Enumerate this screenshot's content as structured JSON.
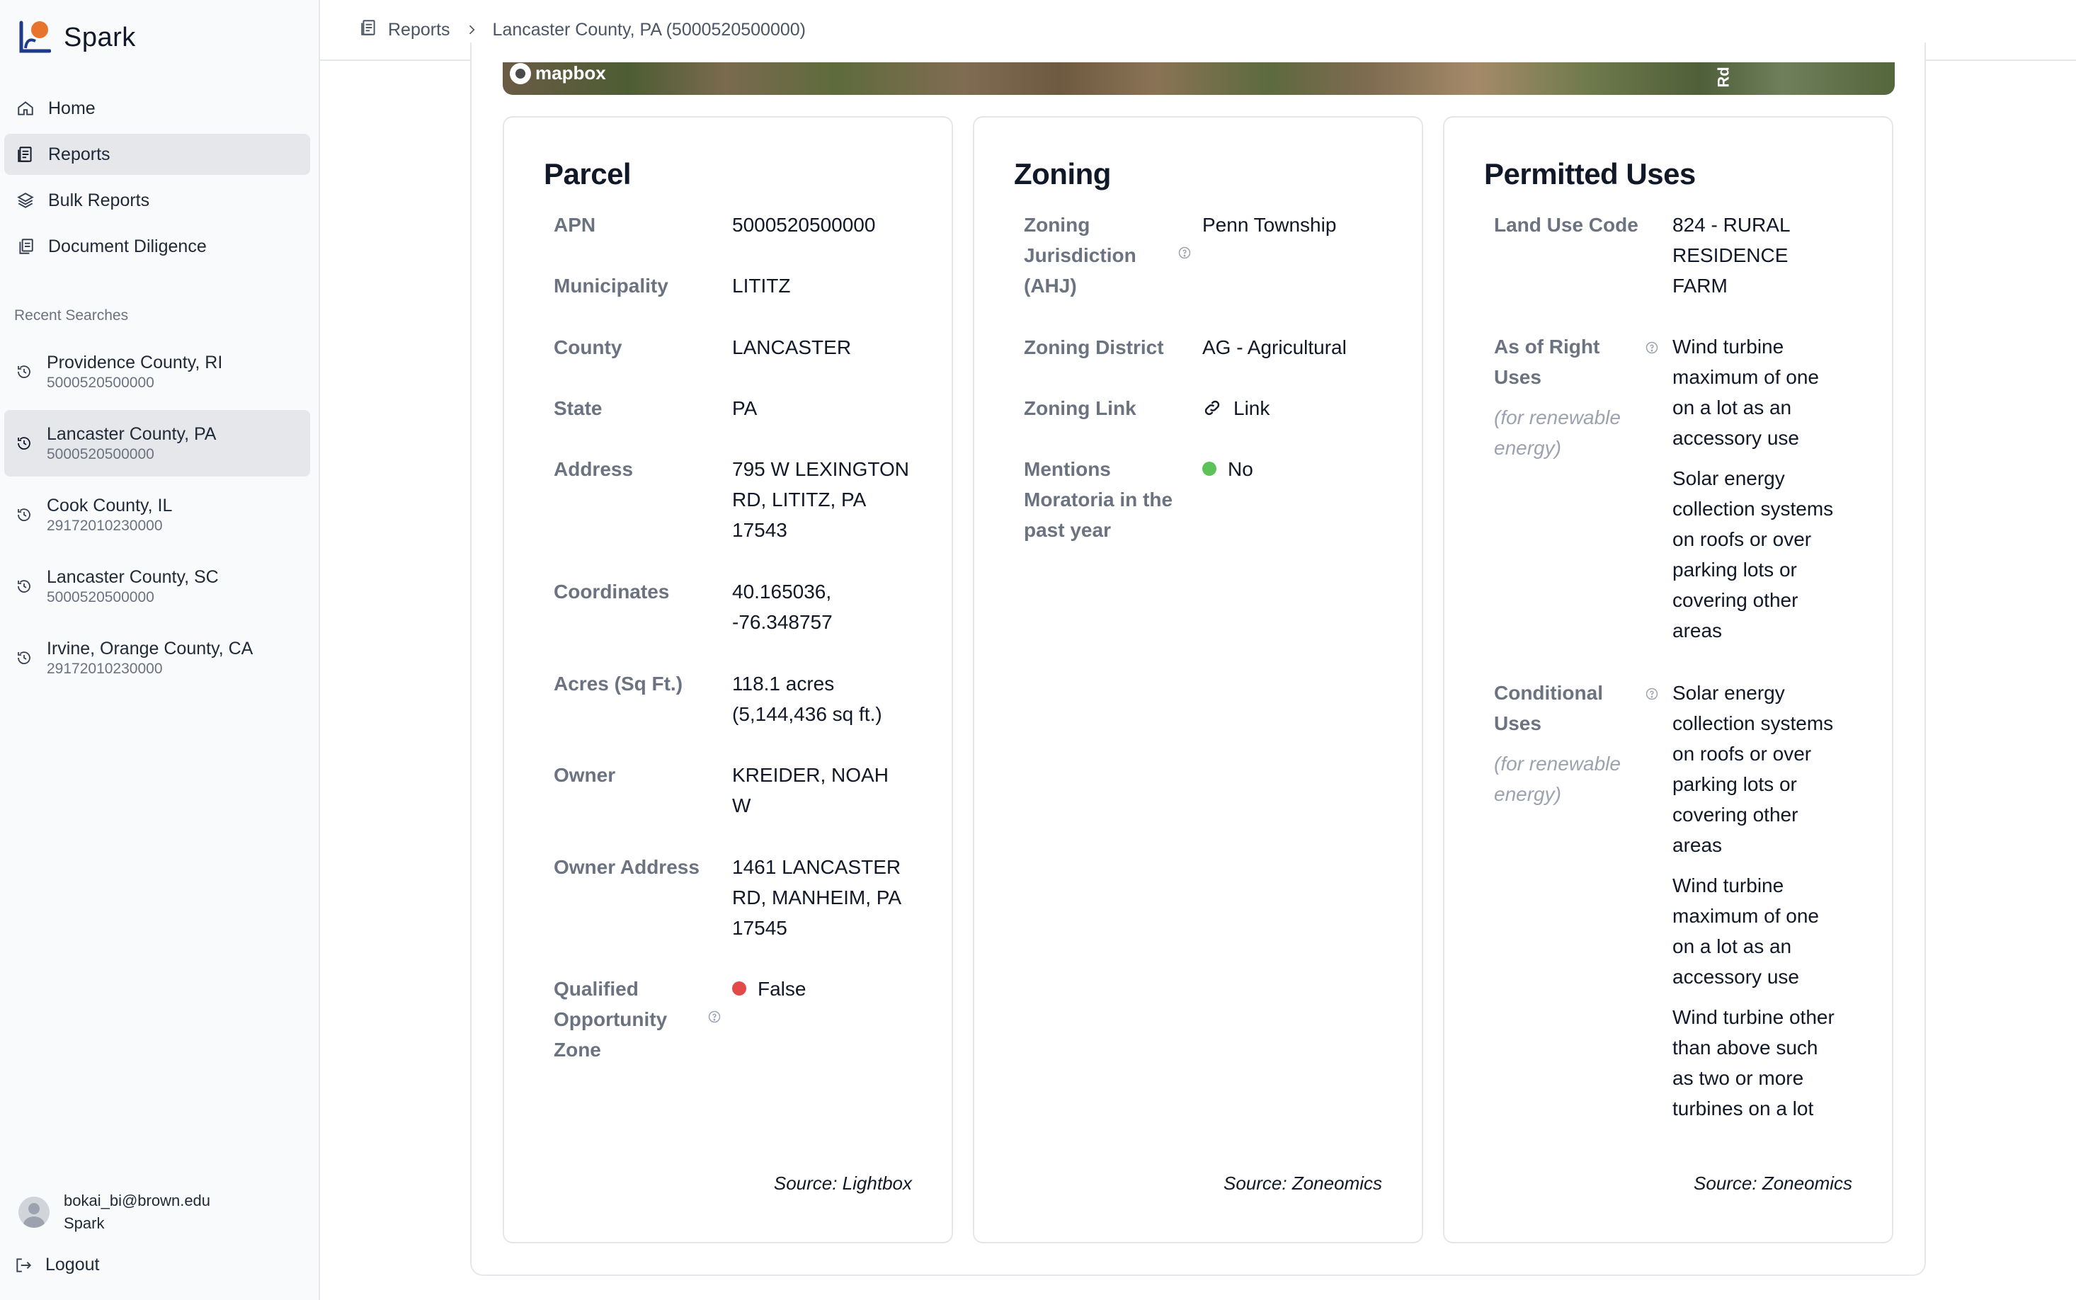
{
  "app": {
    "name": "Spark"
  },
  "nav": {
    "items": [
      {
        "label": "Home",
        "icon": "home-icon",
        "active": false
      },
      {
        "label": "Reports",
        "icon": "reports-icon",
        "active": true
      },
      {
        "label": "Bulk Reports",
        "icon": "layers-icon",
        "active": false
      },
      {
        "label": "Document Diligence",
        "icon": "documents-icon",
        "active": false
      }
    ]
  },
  "recent": {
    "title": "Recent Searches",
    "items": [
      {
        "name": "Providence County, RI",
        "id": "5000520500000"
      },
      {
        "name": "Lancaster County, PA",
        "id": "5000520500000"
      },
      {
        "name": "Cook County, IL",
        "id": "29172010230000"
      },
      {
        "name": "Lancaster County, SC",
        "id": "5000520500000"
      },
      {
        "name": "Irvine, Orange County, CA",
        "id": "29172010230000"
      }
    ]
  },
  "user": {
    "email": "bokai_bi@brown.edu",
    "org": "Spark"
  },
  "logout_label": "Logout",
  "breadcrumb": {
    "root": "Reports",
    "current": "Lancaster County, PA (5000520500000)"
  },
  "map": {
    "attribution": "mapbox",
    "road_label": "Rd"
  },
  "parcel": {
    "title": "Parcel",
    "apn_label": "APN",
    "apn": "5000520500000",
    "municipality_label": "Municipality",
    "municipality": "LITITZ",
    "county_label": "County",
    "county": "LANCASTER",
    "state_label": "State",
    "state": "PA",
    "address_label": "Address",
    "address": "795 W LEXINGTON RD, LITITZ, PA 17543",
    "coordinates_label": "Coordinates",
    "coordinates": "40.165036, -76.348757",
    "acres_label": "Acres (Sq Ft.)",
    "acres": "118.1 acres (5,144,436 sq ft.)",
    "owner_label": "Owner",
    "owner": "KREIDER, NOAH W",
    "owner_address_label": "Owner Address",
    "owner_address": "1461 LANCASTER RD, MANHEIM, PA 17545",
    "qoz_label": "Qualified Opportunity Zone",
    "qoz": "False",
    "source": "Source: Lightbox"
  },
  "zoning": {
    "title": "Zoning",
    "ahj_label": "Zoning Jurisdiction (AHJ)",
    "ahj": "Penn Township",
    "district_label": "Zoning District",
    "district": "AG - Agricultural",
    "link_label": "Zoning Link",
    "link": "Link",
    "moratoria_label": "Mentions Moratoria in the past year",
    "moratoria": "No",
    "source": "Source: Zoneomics"
  },
  "permitted": {
    "title": "Permitted Uses",
    "land_use_label": "Land Use Code",
    "land_use": "824 - RURAL RESIDENCE FARM",
    "as_of_right_label": "As of Right Uses",
    "note": "(for renewable energy)",
    "as_of_right": [
      "Wind turbine maximum of one on a lot as an accessory use",
      "Solar energy collection systems on roofs or over parking lots or covering other areas"
    ],
    "conditional_label": "Conditional Uses",
    "conditional": [
      "Solar energy collection systems on roofs or over parking lots or covering other areas",
      "Wind turbine maximum of one on a lot as an accessory use",
      "Wind turbine other than above such as two or more turbines on a lot"
    ],
    "source": "Source: Zoneomics"
  },
  "colors": {
    "false_dot": "#e24a4a",
    "no_dot": "#5cc25a",
    "logo_orange": "#e8732c",
    "logo_blue": "#1e3a8a"
  }
}
